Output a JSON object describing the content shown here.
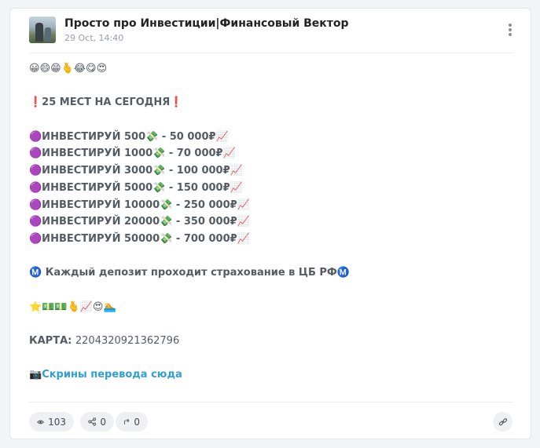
{
  "post": {
    "channel_name": "Просто про Инвестиции|Финансовый Вектор",
    "date": "29 Oct, 14:40",
    "lines": [
      "😀😄😁🫰😂😋😍",
      "",
      "❗25 МЕСТ НА СЕГОДНЯ❗",
      "",
      "🟣ИНВЕСТИРУЙ 500💸 - 50 000₽📈",
      "🟣ИНВЕСТИРУЙ 1000💸 - 70 000₽📈",
      "🟣ИНВЕСТИРУЙ 3000💸 - 100 000₽📈",
      "🟣ИНВЕСТИРУЙ 5000💸 - 150 000₽📈",
      "🟣ИНВЕСТИРУЙ 10000💸 - 250 000₽📈",
      "🟣ИНВЕСТИРУЙ 20000💸 - 350 000₽📈",
      "🟣ИНВЕСТИРУЙ 50000💸 - 700 000₽📈",
      "",
      "Ⓜ️ Каждый депозит проходит страхование в ЦБ РФⓂ️",
      "",
      "⭐💵💵🫰📈😍🏊",
      ""
    ],
    "card_label": "КАРТА:",
    "card_number": "2204320921362796",
    "screens_prefix": "📷",
    "screens_link": "Скрины перевода сюда"
  },
  "footer": {
    "views": "103",
    "shares": "0",
    "forwards": "0"
  },
  "icons": {
    "menu": "more-vertical-icon",
    "views": "eye-icon",
    "shares": "share-icon",
    "forwards": "forward-arrow-icon",
    "link": "link-icon"
  },
  "colors": {
    "link": "#2f9fd5",
    "text": "#555b63"
  }
}
